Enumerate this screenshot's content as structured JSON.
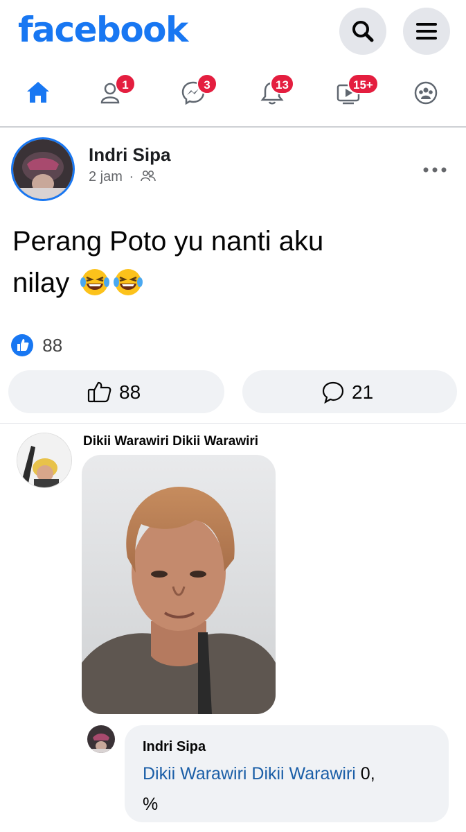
{
  "header": {
    "logo": "facebook",
    "search_icon": "search-icon",
    "menu_icon": "hamburger-menu-icon"
  },
  "nav": {
    "items": [
      {
        "icon": "home-icon",
        "badge": ""
      },
      {
        "icon": "friends-icon",
        "badge": "1"
      },
      {
        "icon": "messenger-icon",
        "badge": "3"
      },
      {
        "icon": "bell-icon",
        "badge": "13"
      },
      {
        "icon": "watch-icon",
        "badge": "15+"
      },
      {
        "icon": "groups-icon",
        "badge": ""
      }
    ]
  },
  "post": {
    "author": "Indri Sipa",
    "time": "2 jam",
    "separator": "·",
    "audience_icon": "friends-audience-icon",
    "text_line1": "Perang Poto yu nanti aku",
    "text_line2": "nilay",
    "emojis": [
      "laughing-tears-emoji",
      "laughing-tears-emoji"
    ],
    "reaction_count": "88",
    "like_count": "88",
    "comment_count": "21"
  },
  "comment": {
    "author": "Dikii Warawiri Dikii Warawiri"
  },
  "reply": {
    "author": "Indri Sipa",
    "mention": "Dikii Warawiri Dikii Warawiri",
    "text_after_mention": " 0,",
    "text_line2": "%"
  },
  "colors": {
    "brand": "#1877f2",
    "badge": "#e41e3f",
    "mention": "#1a5ea7"
  }
}
